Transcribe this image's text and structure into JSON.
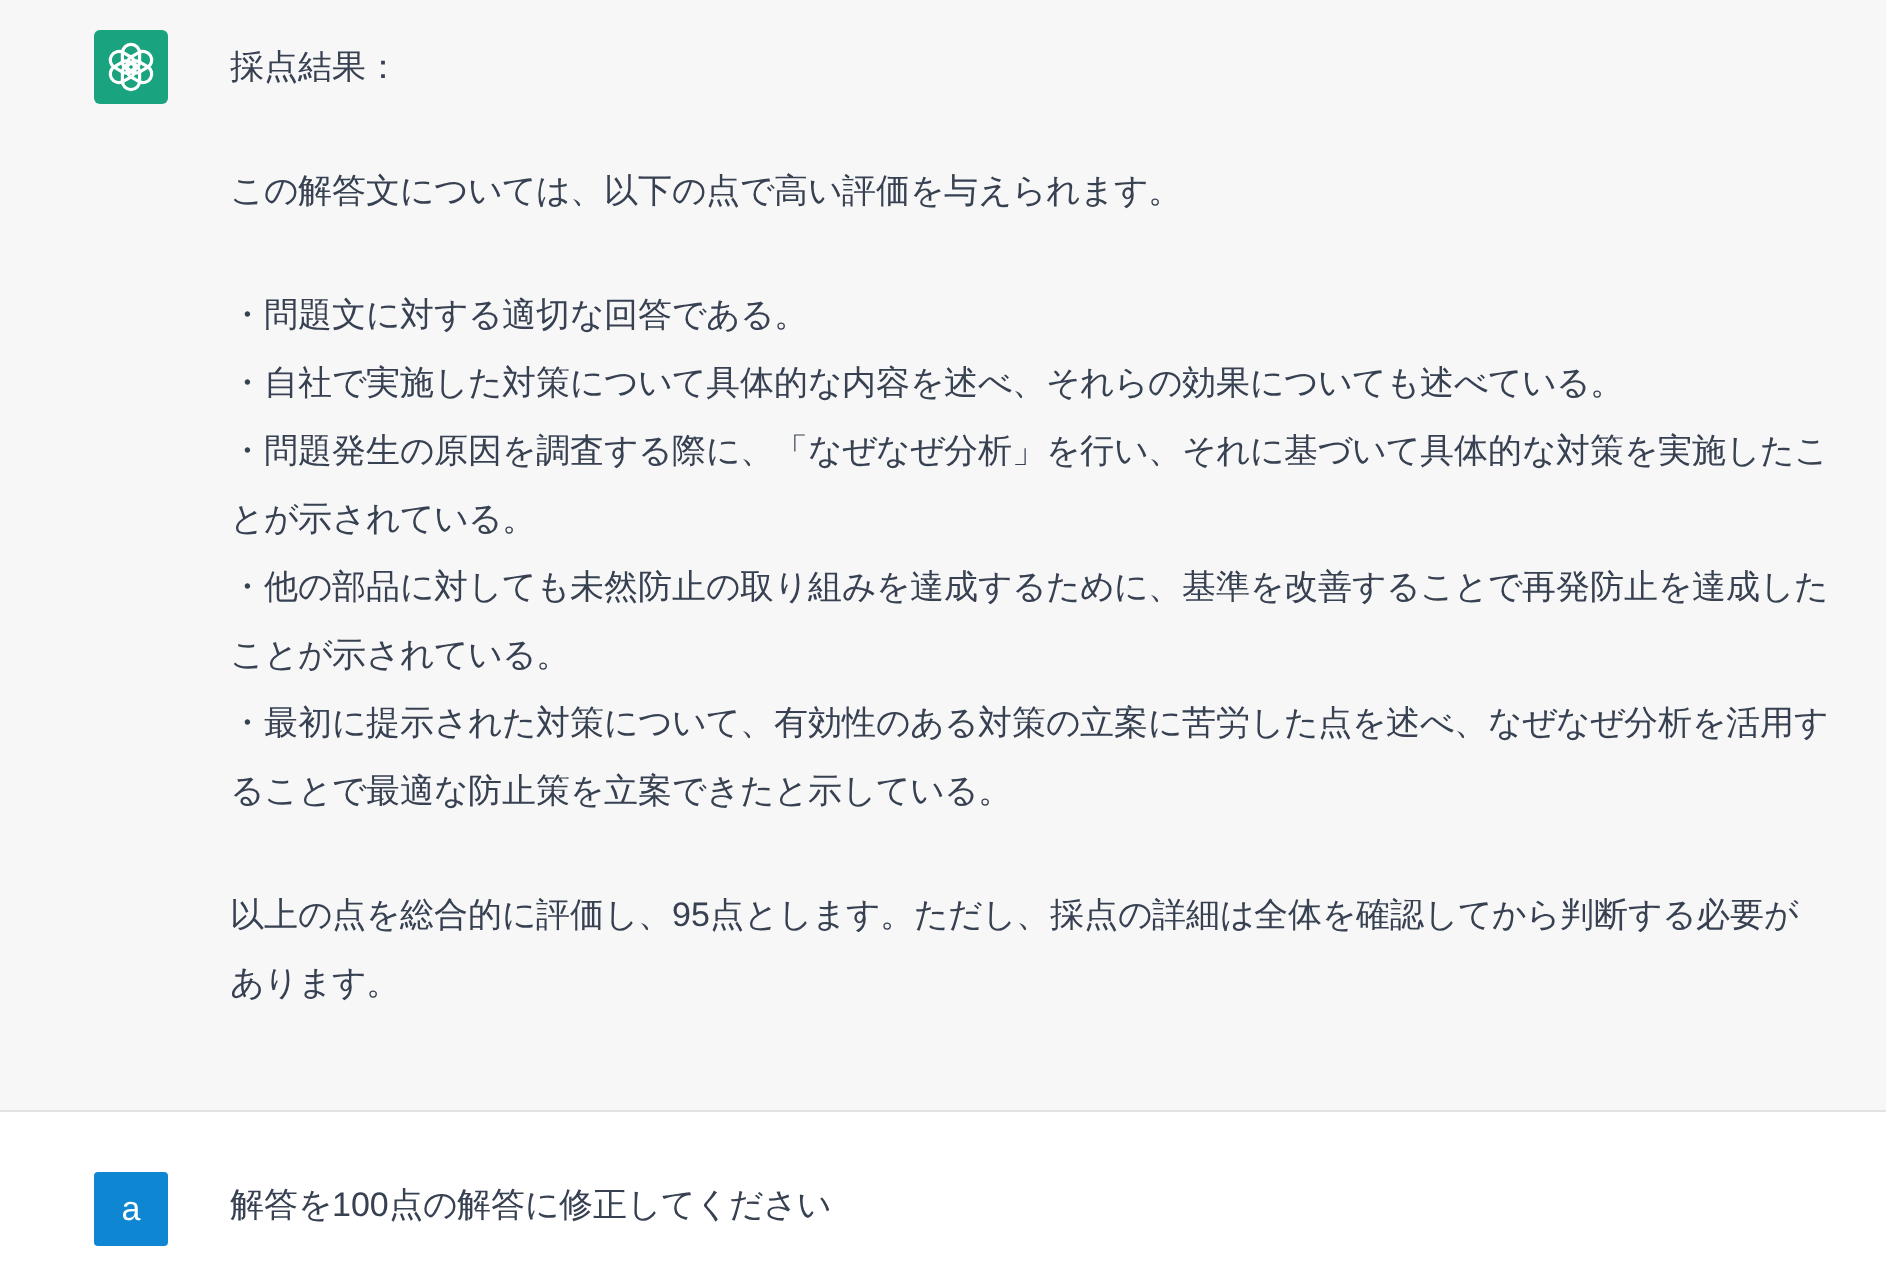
{
  "conversation": [
    {
      "kind": "assistant",
      "blocks": [
        {
          "kind": "paragraph",
          "text": "採点結果："
        },
        {
          "kind": "paragraph",
          "text": "この解答文については、以下の点で高い評価を与えられます。"
        },
        {
          "kind": "list",
          "items": [
            "・問題文に対する適切な回答である。",
            "・自社で実施した対策について具体的な内容を述べ、それらの効果についても述べている。",
            "・問題発生の原因を調査する際に、「なぜなぜ分析」を行い、それに基づいて具体的な対策を実施したことが示されている。",
            "・他の部品に対しても未然防止の取り組みを達成するために、基準を改善することで再発防止を達成したことが示されている。",
            "・最初に提示された対策について、有効性のある対策の立案に苦労した点を述べ、なぜなぜ分析を活用することで最適な防止策を立案できたと示している。"
          ]
        },
        {
          "kind": "paragraph",
          "text": "以上の点を総合的に評価し、95点とします。ただし、採点の詳細は全体を確認してから判断する必要があります。"
        }
      ]
    },
    {
      "kind": "user",
      "avatar_letter": "a",
      "blocks": [
        {
          "kind": "paragraph",
          "text": "解答を100点の解答に修正してください"
        }
      ]
    }
  ]
}
